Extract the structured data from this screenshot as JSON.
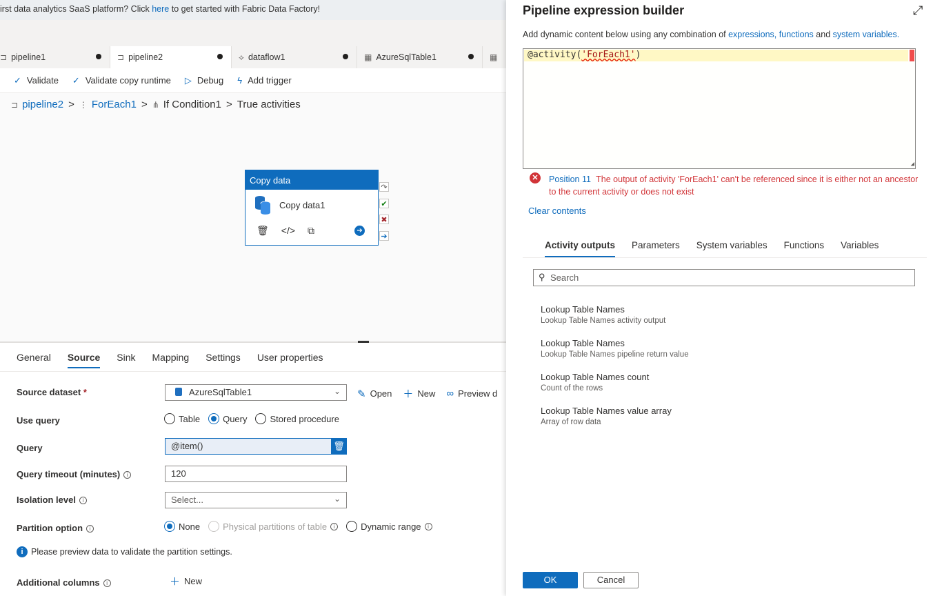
{
  "banner": {
    "text_before": "irst data analytics SaaS platform? Click ",
    "link": "here",
    "text_after": " to get started with Fabric Data Factory!"
  },
  "tabs": [
    {
      "label": "pipeline1",
      "icon": "pipeline-icon"
    },
    {
      "label": "pipeline2",
      "icon": "pipeline-icon"
    },
    {
      "label": "dataflow1",
      "icon": "dataflow-icon"
    },
    {
      "label": "AzureSqlTable1",
      "icon": "table-icon"
    }
  ],
  "toolbar": {
    "validate": "Validate",
    "validate_copy": "Validate copy runtime",
    "debug": "Debug",
    "add_trigger": "Add trigger"
  },
  "breadcrumb": {
    "items": [
      "pipeline2",
      "ForEach1",
      "If Condition1",
      "True activities"
    ]
  },
  "activity": {
    "header": "Copy data",
    "name": "Copy data1"
  },
  "properties": {
    "tabs": [
      "General",
      "Source",
      "Sink",
      "Mapping",
      "Settings",
      "User properties"
    ],
    "source_dataset_label": "Source dataset",
    "source_dataset_value": "AzureSqlTable1",
    "open": "Open",
    "new": "New",
    "preview": "Preview d",
    "use_query_label": "Use query",
    "use_query_options": [
      "Table",
      "Query",
      "Stored procedure"
    ],
    "query_label": "Query",
    "query_value": "@item()",
    "timeout_label": "Query timeout (minutes)",
    "timeout_value": "120",
    "isolation_label": "Isolation level",
    "isolation_placeholder": "Select...",
    "partition_label": "Partition option",
    "partition_options": [
      "None",
      "Physical partitions of table",
      "Dynamic range"
    ],
    "partition_note": "Please preview data to validate the partition settings.",
    "additional_label": "Additional columns",
    "additional_new": "New"
  },
  "panel": {
    "title": "Pipeline expression builder",
    "desc_prefix": "Add dynamic content below using any combination of ",
    "desc_link1": "expressions,",
    "desc_link2": "functions",
    "desc_and": " and ",
    "desc_link3": "system variables.",
    "expression_prefix": "@activity(",
    "expression_string": "'ForEach1'",
    "expression_suffix": ")",
    "error_position": "Position 11",
    "error_message": "The output of activity 'ForEach1' can't be referenced since it is either not an ancestor to the current activity or does not exist",
    "clear_contents": "Clear contents",
    "tabs": [
      "Activity outputs",
      "Parameters",
      "System variables",
      "Functions",
      "Variables"
    ],
    "search_placeholder": "Search",
    "items": [
      {
        "title": "Lookup Table Names",
        "subtitle": "Lookup Table Names activity output"
      },
      {
        "title": "Lookup Table Names",
        "subtitle": "Lookup Table Names pipeline return value"
      },
      {
        "title": "Lookup Table Names count",
        "subtitle": "Count of the rows"
      },
      {
        "title": "Lookup Table Names value array",
        "subtitle": "Array of row data"
      }
    ],
    "ok": "OK",
    "cancel": "Cancel"
  },
  "colors": {
    "accent": "#0f6cbd",
    "error": "#d13438"
  }
}
